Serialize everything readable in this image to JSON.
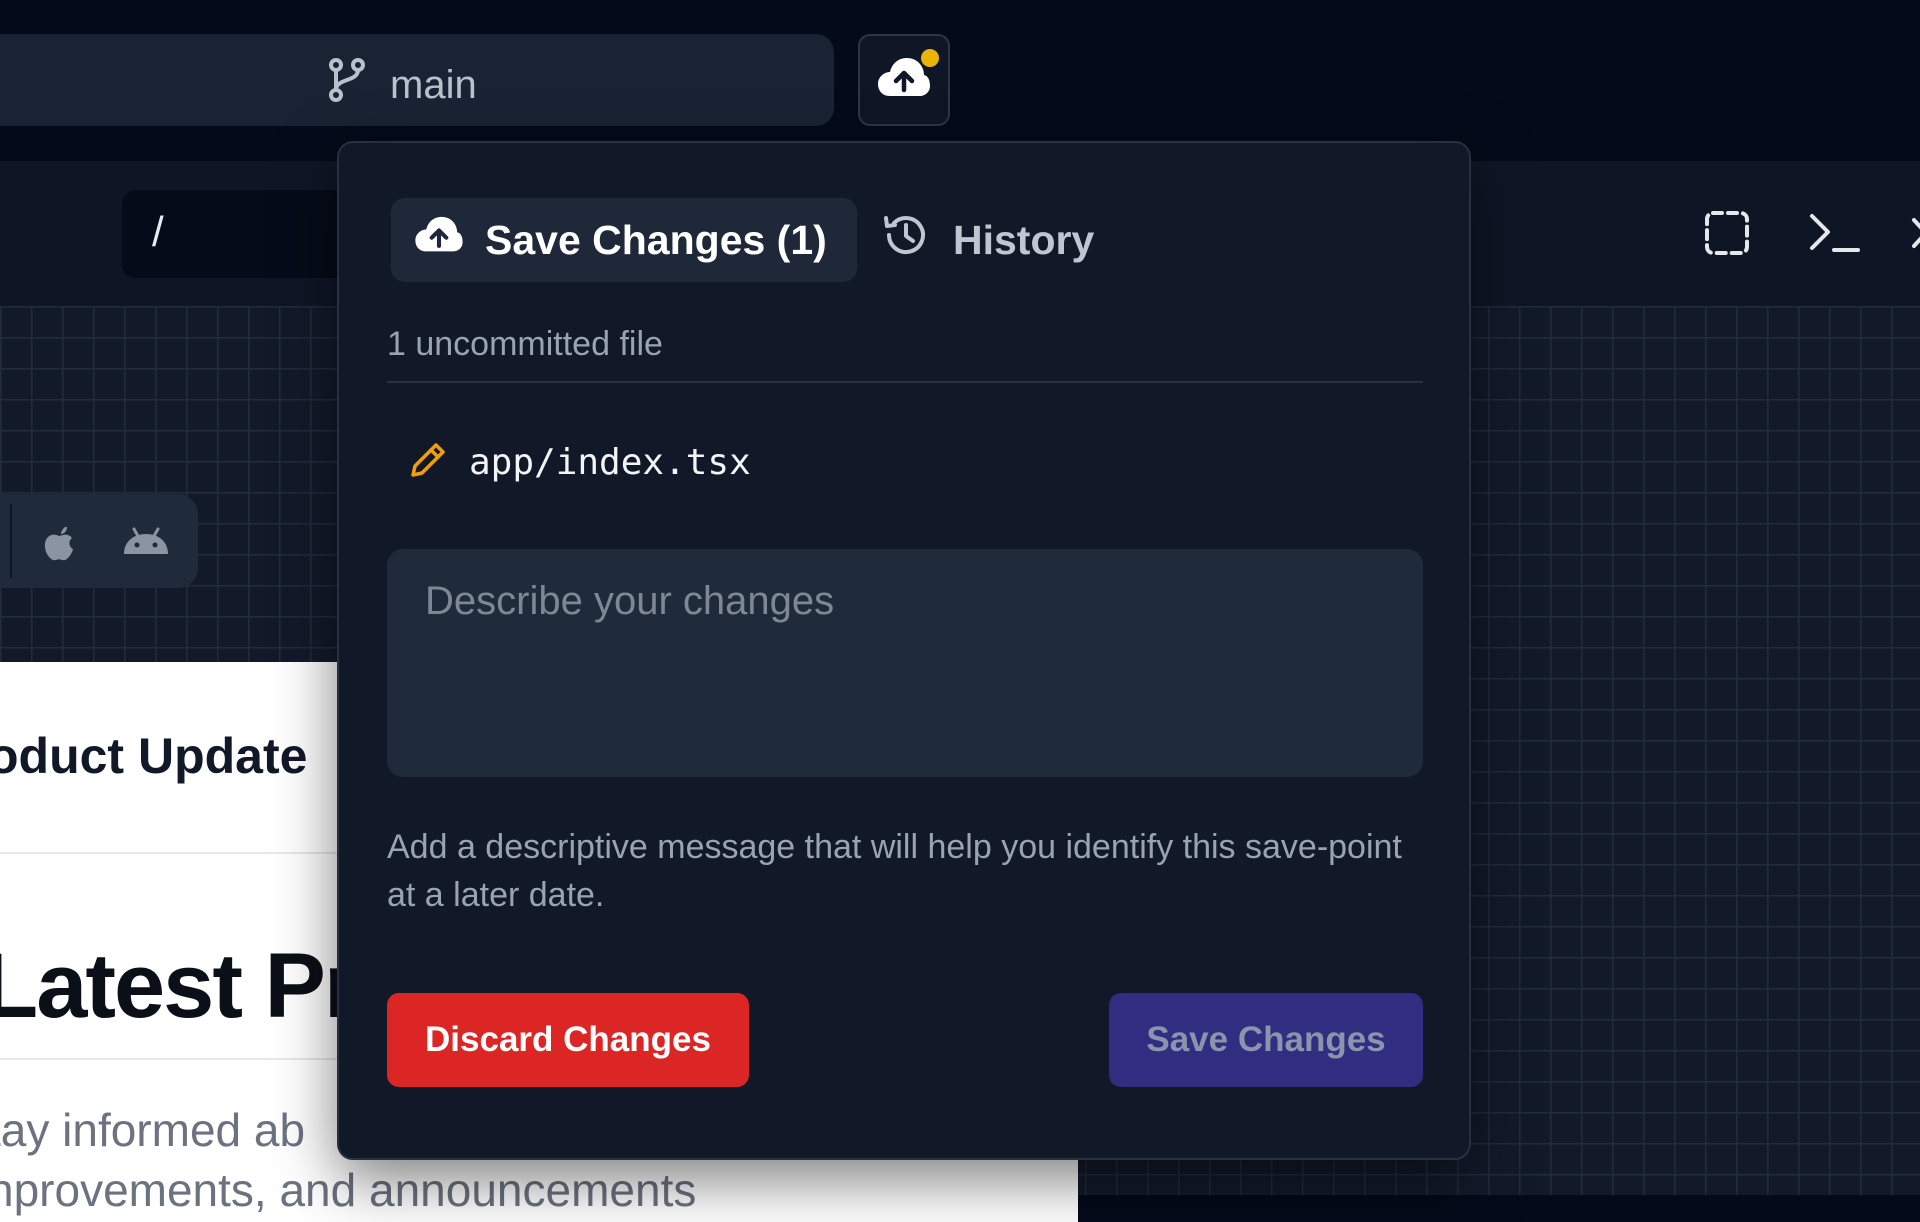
{
  "topbar": {
    "branch": "main",
    "has_unsaved_indicator": true,
    "indicator_color": "#eab308"
  },
  "toolbar": {
    "path": "/"
  },
  "preview": {
    "title_fragment": "oduct Update",
    "heading_fragment": "Latest Pro",
    "text_line1": "tay informed ab",
    "text_line2": "nprovements, and announcements"
  },
  "panel": {
    "tabs": [
      {
        "label": "Save Changes (1)",
        "icon": "cloud-upload-icon",
        "active": true
      },
      {
        "label": "History",
        "icon": "history-icon",
        "active": false
      }
    ],
    "uncommitted_label": "1 uncommitted file",
    "files": [
      {
        "name": "app/index.tsx",
        "icon": "pencil-icon",
        "status_color": "#f59e0b"
      }
    ],
    "message_placeholder": "Describe your changes",
    "hint": "Add a descriptive message that will help you identify this save-point at a later date.",
    "discard_label": "Discard Changes",
    "save_label": "Save Changes"
  },
  "colors": {
    "discard": "#dc2626",
    "save": "#312e81",
    "background": "#040a19"
  }
}
